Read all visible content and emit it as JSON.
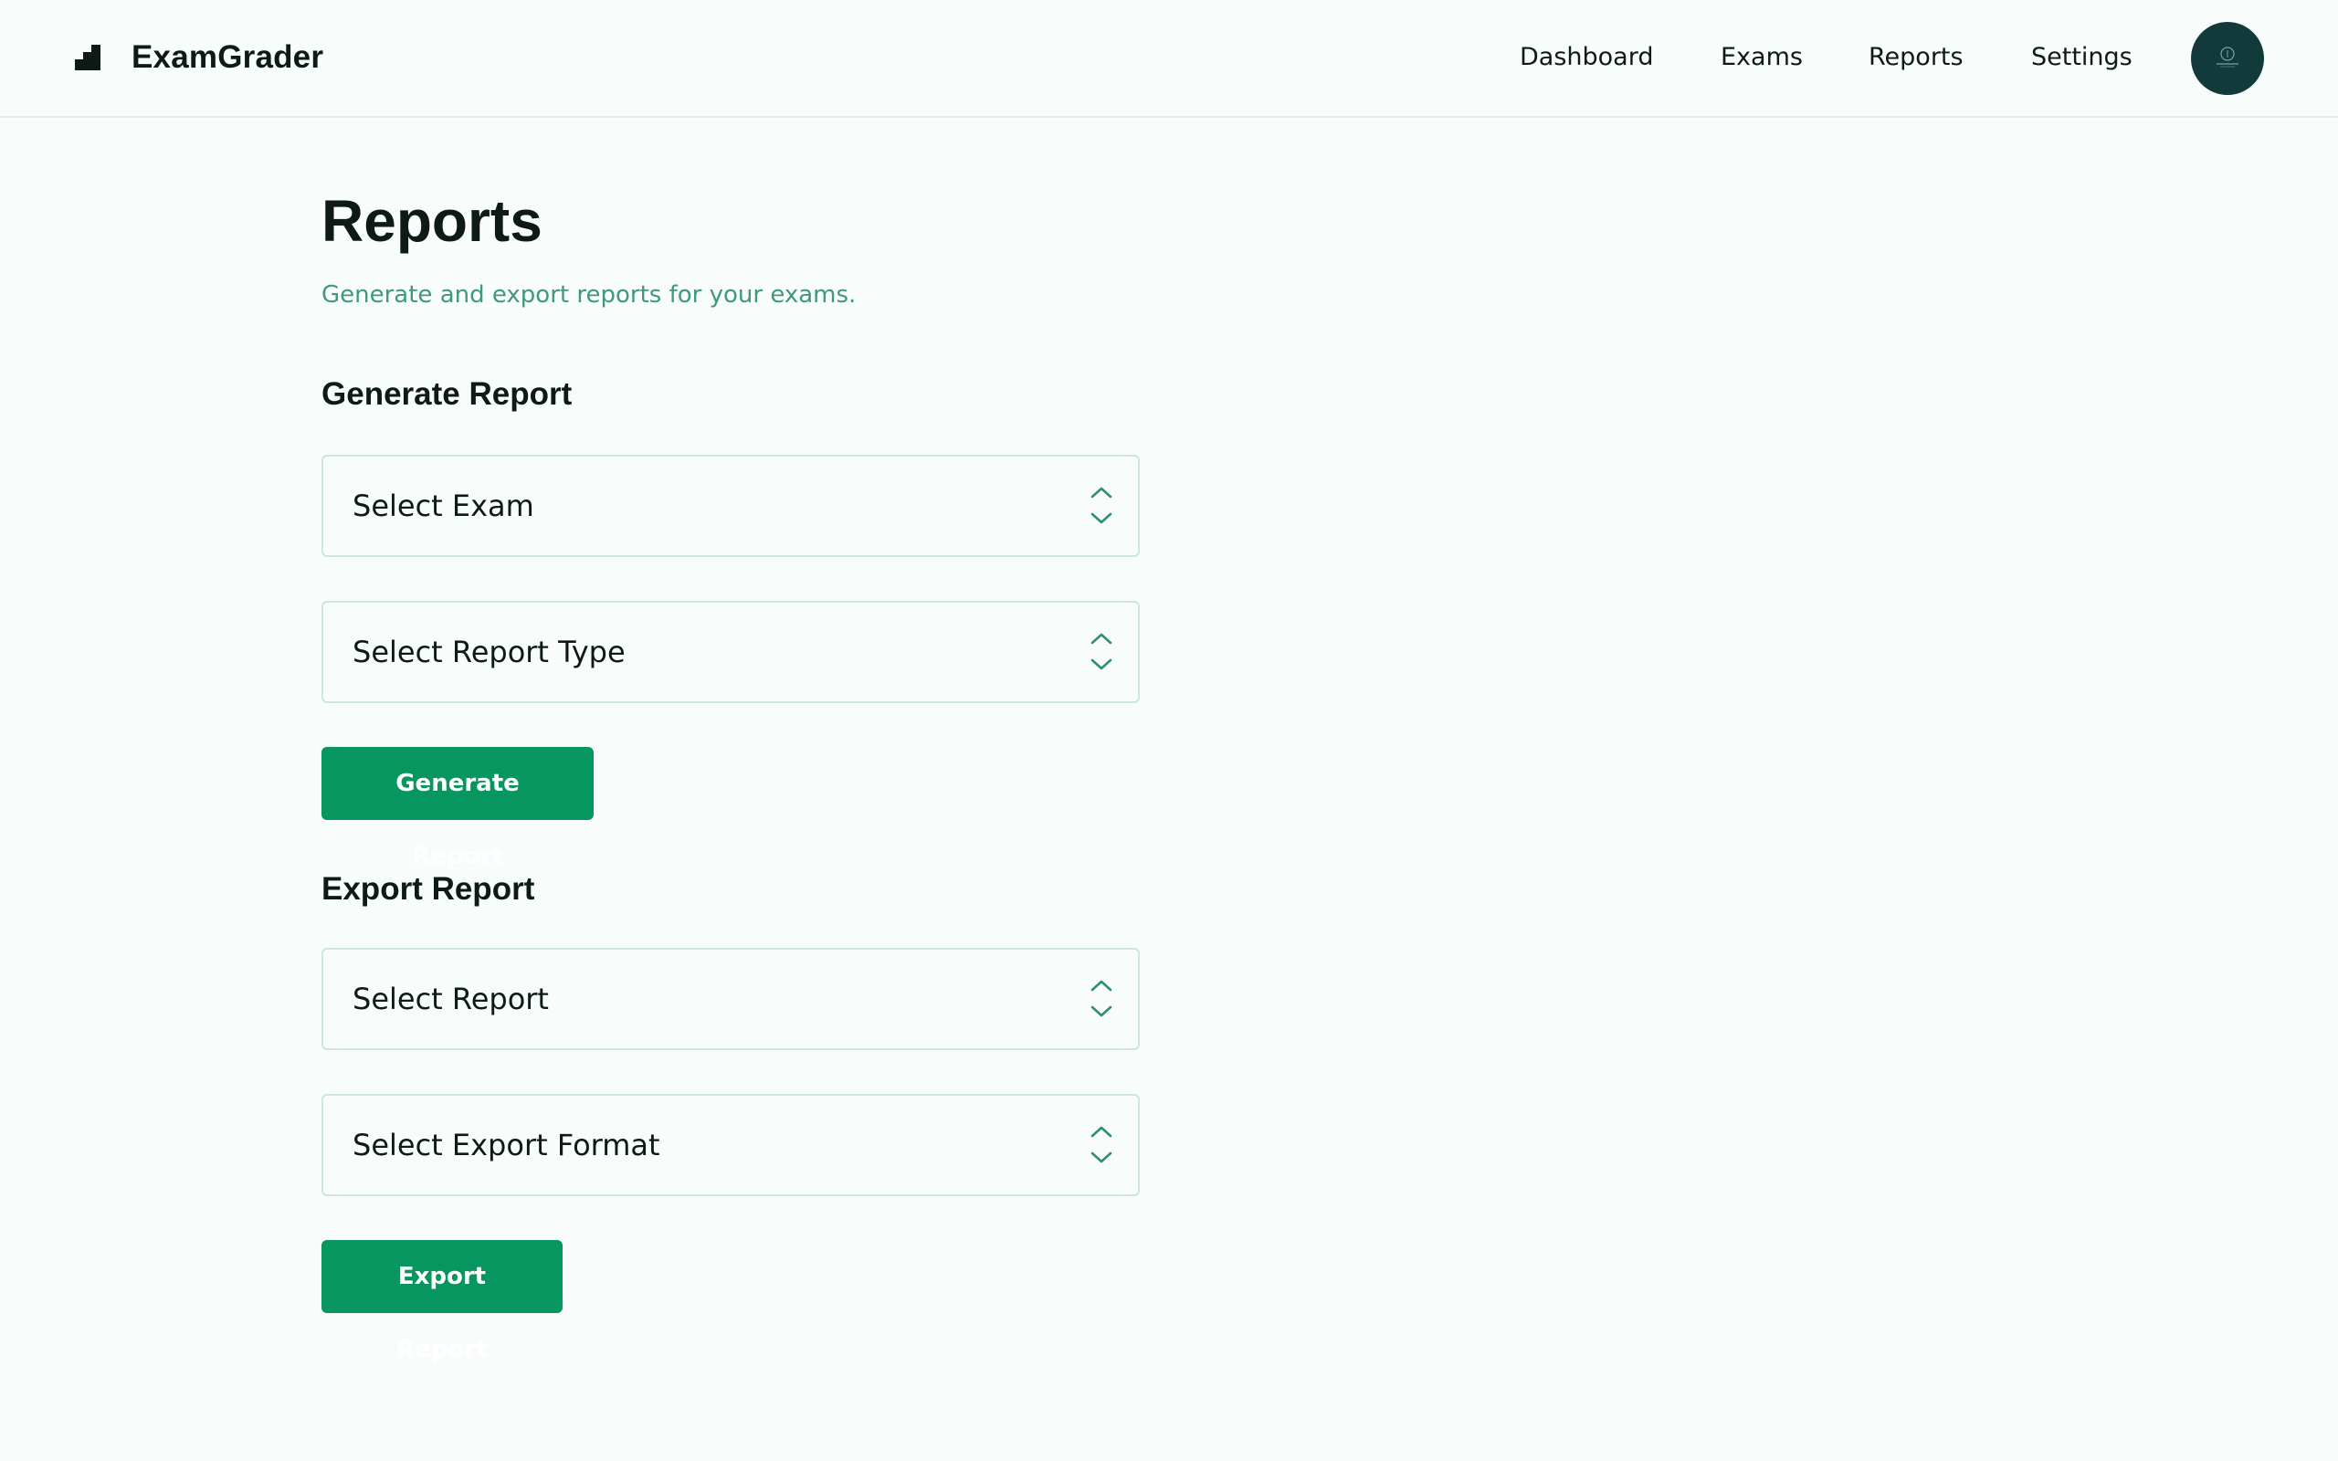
{
  "brand": {
    "name": "ExamGrader",
    "icon": "logo-steps-icon"
  },
  "nav": {
    "items": [
      {
        "label": "Dashboard"
      },
      {
        "label": "Exams"
      },
      {
        "label": "Reports"
      },
      {
        "label": "Settings"
      }
    ]
  },
  "user": {
    "avatar_icon": "user-avatar"
  },
  "page": {
    "title": "Reports",
    "subtitle": "Generate and export reports for your exams."
  },
  "generate": {
    "heading": "Generate Report",
    "exam_select": "Select Exam",
    "type_select": "Select Report Type",
    "button": "Generate Report"
  },
  "export": {
    "heading": "Export Report",
    "report_select": "Select Report",
    "format_select": "Select Export Format",
    "button": "Export Report"
  },
  "colors": {
    "accent": "#07965f",
    "subtitle": "#3e9a7a",
    "avatar_bg": "#123a3a",
    "chevron": "#2f8f6f"
  },
  "icons": {
    "select": "chevron-up-down-icon"
  }
}
